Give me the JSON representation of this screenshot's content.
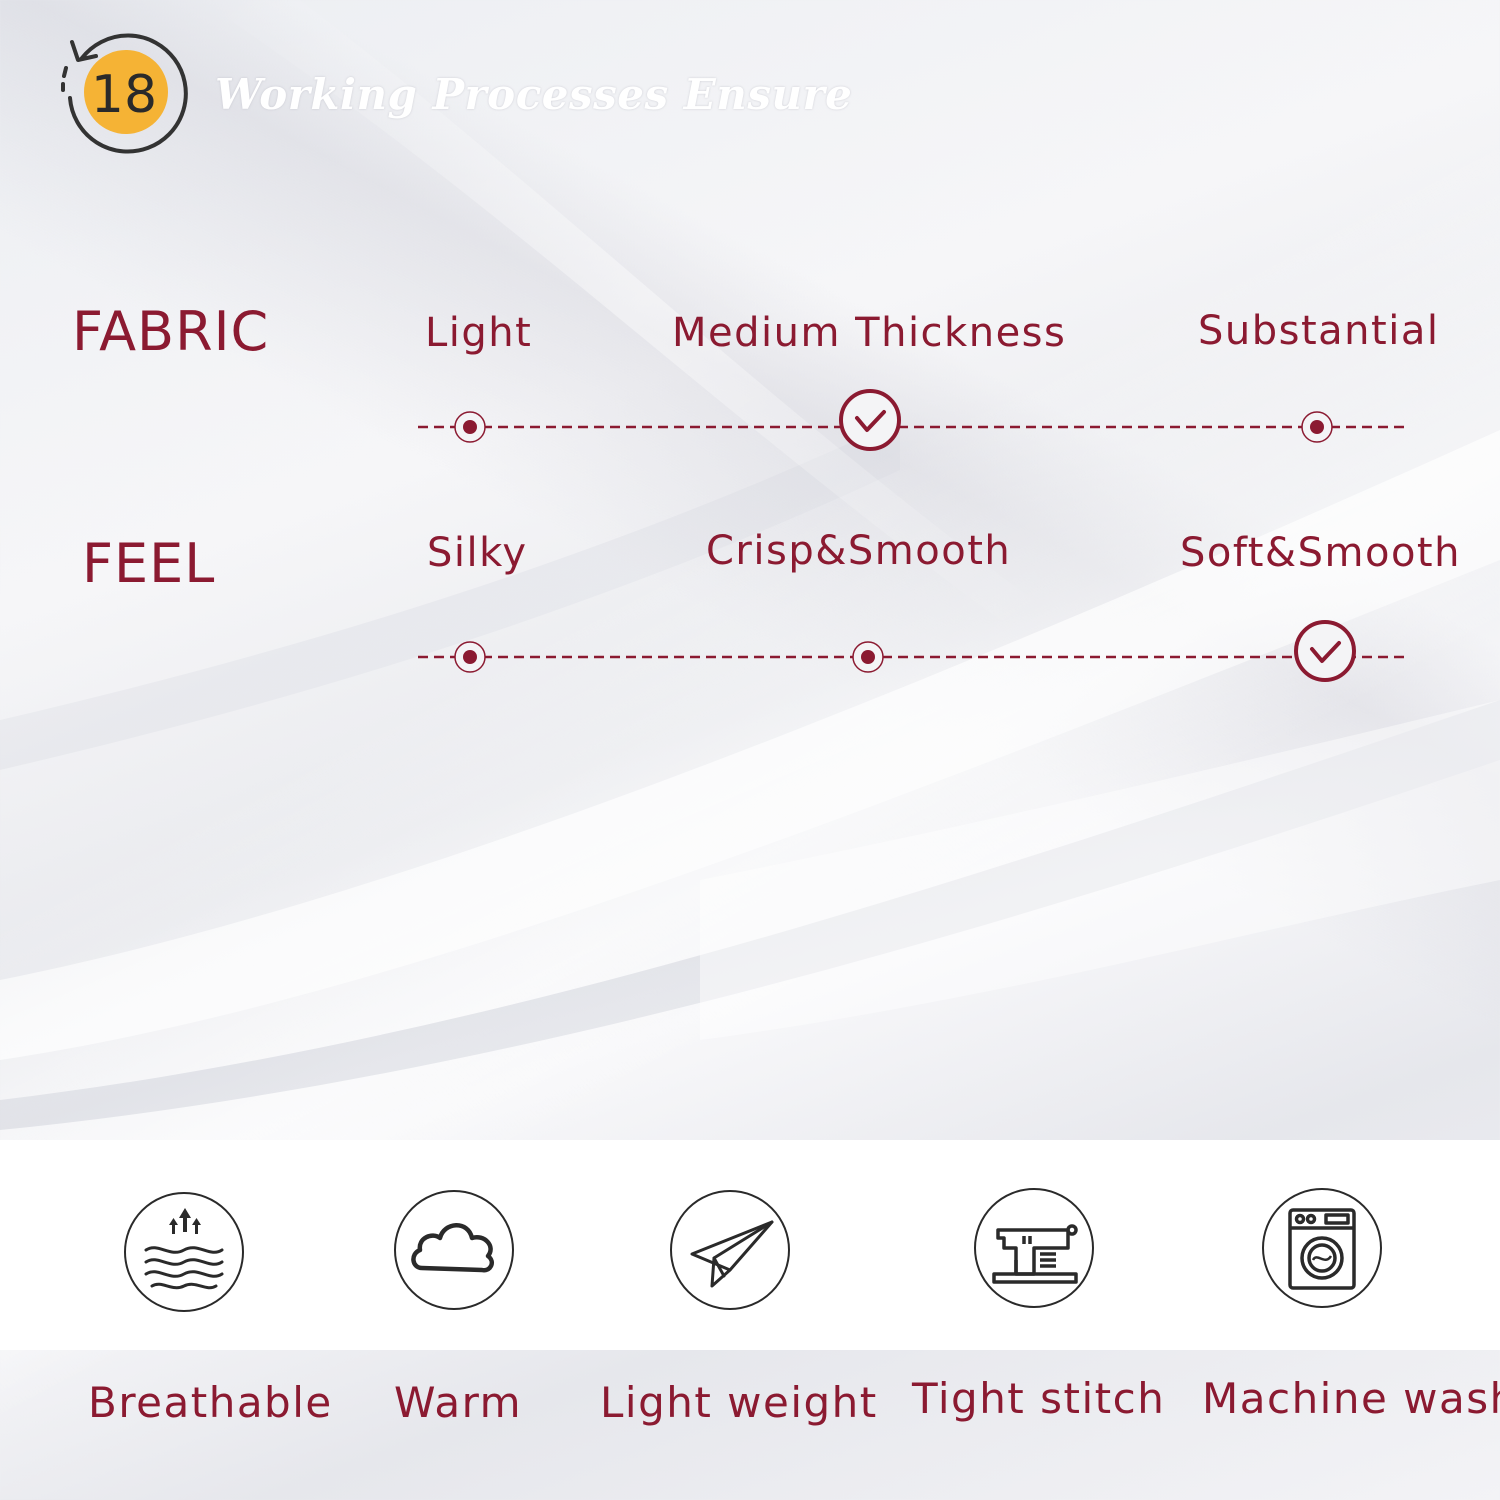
{
  "header": {
    "badge_number": "18",
    "title": "Working Processes Ensure"
  },
  "fabric": {
    "label": "FABRIC",
    "options": [
      "Light",
      "Medium Thickness",
      "Substantial"
    ],
    "selected": "Medium Thickness"
  },
  "feel": {
    "label": "FEEL",
    "options": [
      "Silky",
      "Crisp&Smooth",
      "Soft&Smooth"
    ],
    "selected": "Soft&Smooth"
  },
  "features": [
    {
      "label": "Breathable",
      "icon": "breathable-icon"
    },
    {
      "label": "Warm",
      "icon": "cloud-icon"
    },
    {
      "label": "Light weight",
      "icon": "paper-plane-icon"
    },
    {
      "label": "Tight stitch",
      "icon": "sewing-machine-icon"
    },
    {
      "label": "Machine wash",
      "icon": "washing-machine-icon"
    }
  ],
  "colors": {
    "accent": "#8b1a31",
    "badge": "#f5b335",
    "icon_stroke": "#2a2a2a"
  }
}
